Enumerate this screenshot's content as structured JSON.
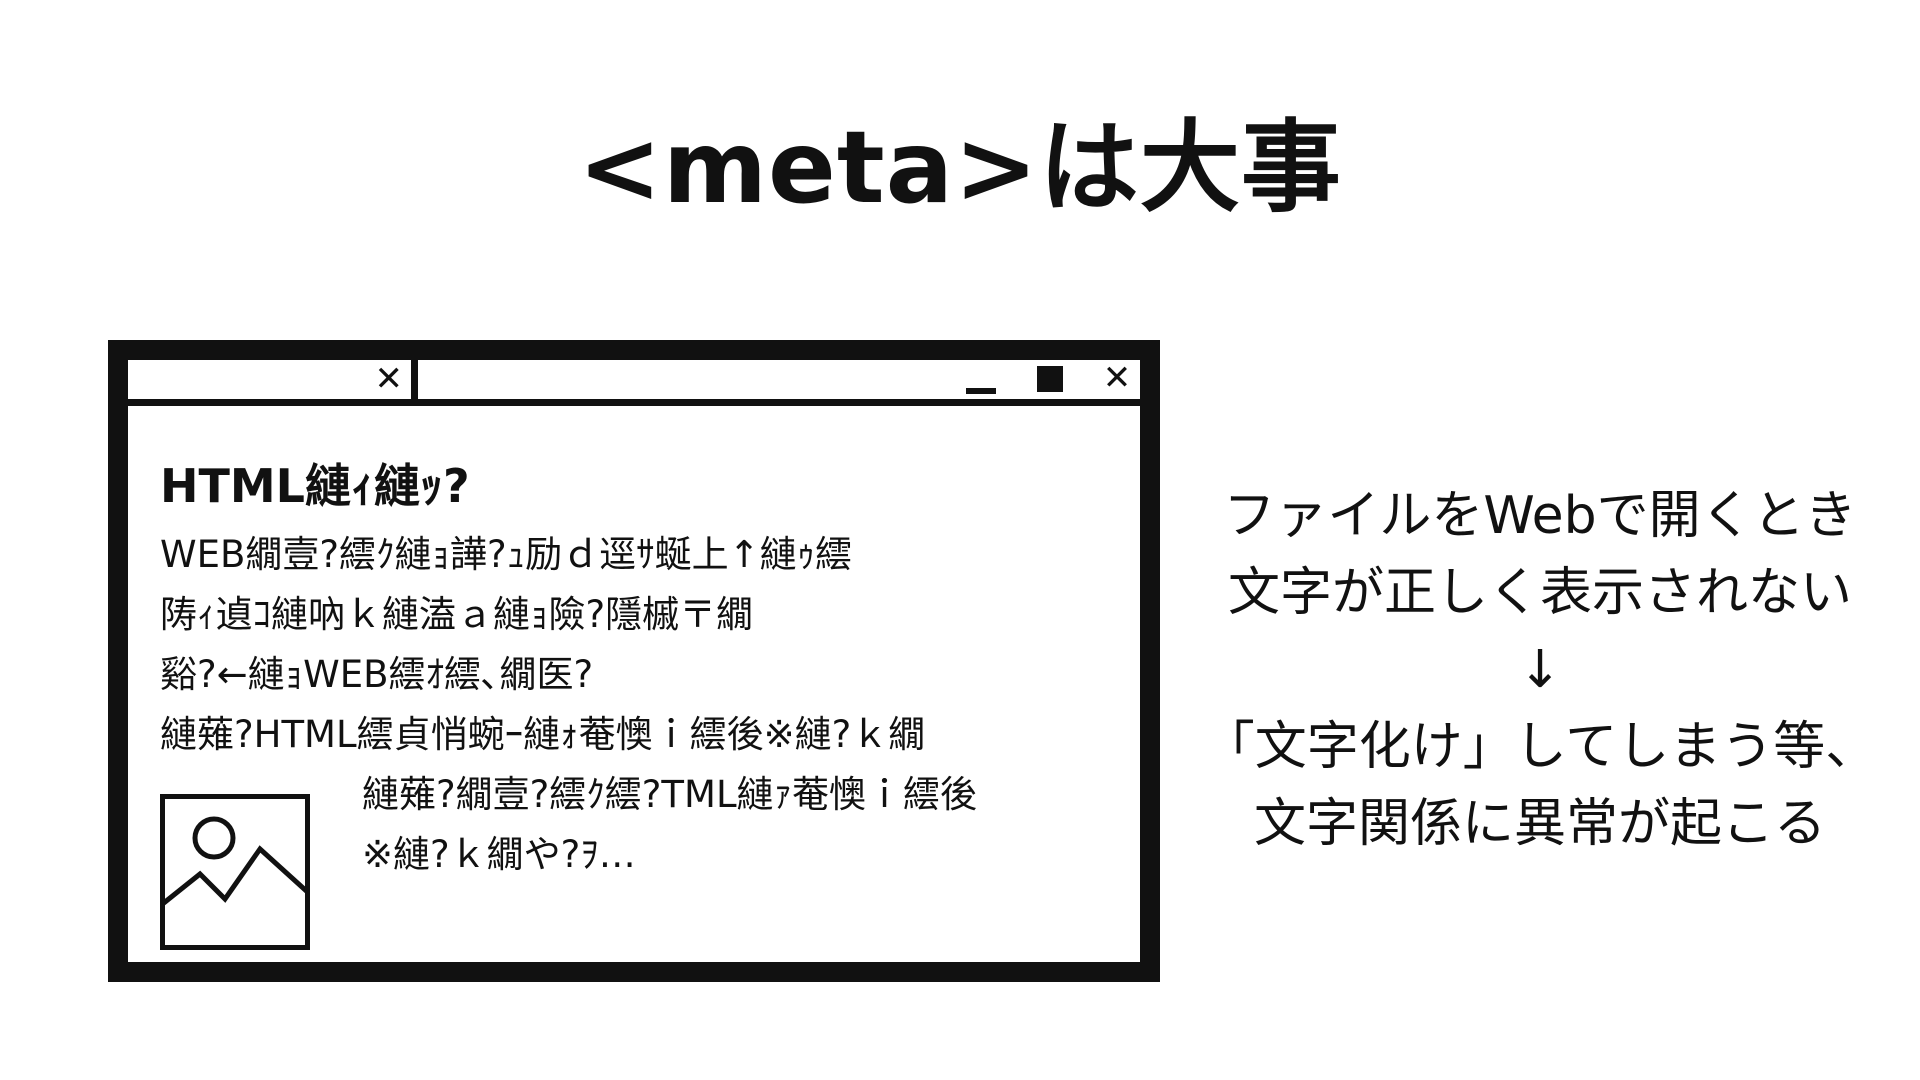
{
  "title": "<meta>は大事",
  "browser": {
    "tab_close_glyph": "✕",
    "close_glyph": "✕",
    "icons": [
      "close-icon",
      "minimize-icon",
      "maximize-icon",
      "image-placeholder-icon"
    ],
    "page_heading": "HTML縺ｨ縺ｯ?",
    "garbled_lines": [
      "WEB繝壹?繧ｸ縺ｮ譁?ｭ励ｄ逕ｻ蜒上↑縺ｩ繧",
      "陦ｨ遉ｺ縺吶ｋ縺溘ａ縺ｮ險?隱槭〒繝",
      "谿?←縺ｮWEB繧ｵ繧､繝医?",
      "縺薙?HTML繧貞悄蜿ｰ縺ｫ菴懊ｉ繧後※縺?ｋ繝",
      "縺薙?繝壹?繧ｸ繧?TML縺ｧ菴懊ｉ繧後",
      "※縺?ｋ繝や?ｦ…"
    ]
  },
  "explanation": {
    "lines": [
      "ファイルをWebで開くとき",
      "文字が正しく表示されない",
      "↓",
      "「文字化け」してしまう等、",
      "文字関係に異常が起こる"
    ]
  },
  "colors": {
    "ink": "#111111",
    "background": "#ffffff"
  }
}
